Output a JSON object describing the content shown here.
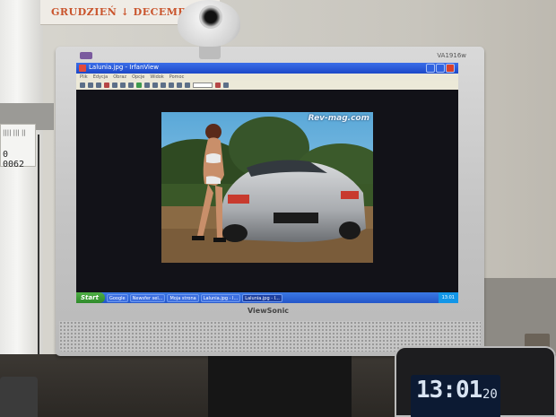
{
  "calendar": {
    "text": "GRUDZIEŃ ↓ DECEMBER"
  },
  "sticker": {
    "code": "0 0062"
  },
  "monitor": {
    "model": "VA1916w",
    "brand": "ViewSonic"
  },
  "window": {
    "title": "Lalunia.jpg - IrfanView",
    "menu": [
      "Plik",
      "Edycja",
      "Obraz",
      "Opcje",
      "Widok",
      "Pomoc"
    ],
    "watermark": "Rev-mag.com"
  },
  "taskbar": {
    "start_label": "Start",
    "items": [
      {
        "label": "Google",
        "active": false
      },
      {
        "label": "Newsfer sel...",
        "active": false
      },
      {
        "label": "Moja strona",
        "active": false
      },
      {
        "label": "Lalunia.jpg - I...",
        "active": false
      },
      {
        "label": "Lalunia.jpg - I...",
        "active": true
      }
    ],
    "clock": "13:01"
  },
  "desk_clock": {
    "time": "13:01",
    "seconds": "20"
  },
  "colors": {
    "titlebar": "#1c48c8",
    "taskbar": "#2456c9",
    "start": "#2f8b2b"
  }
}
